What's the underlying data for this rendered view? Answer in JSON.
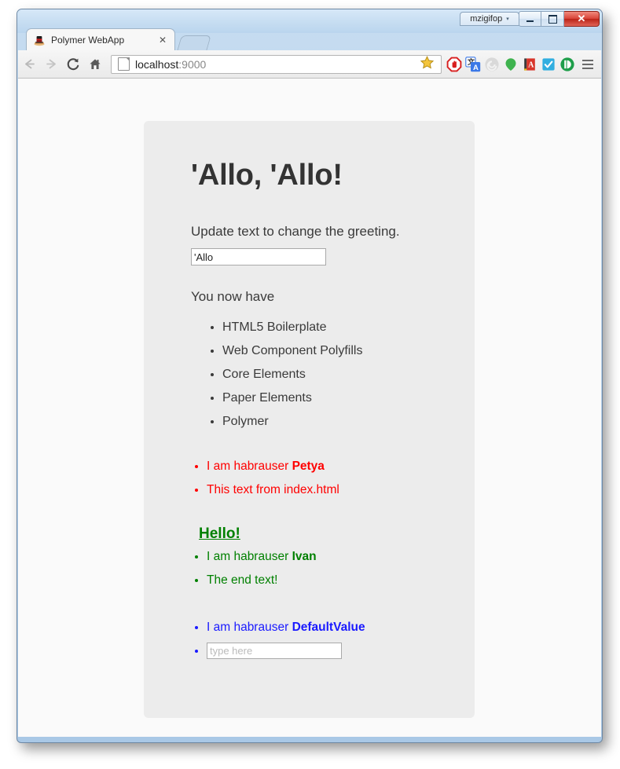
{
  "window": {
    "profile_name": "mzigifop",
    "profile_chevron": "▾",
    "minimize_label": "minimize",
    "maximize_label": "maximize",
    "close_label": "✕"
  },
  "tabs": [
    {
      "title": "Polymer WebApp",
      "close_label": "✕",
      "favicon": "polymer-webapp-favicon"
    }
  ],
  "new_tab_label": "new-tab",
  "toolbar": {
    "back_label": "←",
    "forward_label": "→",
    "reload_label": "↻",
    "home_label": "home",
    "url_host": "localhost",
    "url_port": ":9000",
    "url_full": "localhost:9000",
    "page_icon": "page-icon",
    "star_icon": "bookmark-star-icon",
    "extensions": [
      {
        "name": "adblock-icon"
      },
      {
        "name": "google-translate-icon"
      },
      {
        "name": "spiral-icon"
      },
      {
        "name": "green-balloon-icon"
      },
      {
        "name": "dictionary-book-icon"
      },
      {
        "name": "blue-checkbox-icon"
      },
      {
        "name": "pocket-icon"
      }
    ],
    "menu_label": "chrome-menu"
  },
  "page": {
    "heading": "'Allo, 'Allo!",
    "instruction": "Update text to change the greeting.",
    "greeting_input": {
      "value": "'Allo",
      "placeholder": ""
    },
    "have_text": "You now have",
    "features": [
      "HTML5 Boilerplate",
      "Web Component Polyfills",
      "Core Elements",
      "Paper Elements",
      "Polymer"
    ],
    "red_block": {
      "color": "#ff0000",
      "items": [
        {
          "prefix": "I am habrauser ",
          "strong": "Petya"
        },
        {
          "prefix": "This text from index.html",
          "strong": ""
        }
      ]
    },
    "hello_heading": "Hello!",
    "green_block": {
      "color": "#008000",
      "items": [
        {
          "prefix": "I am habrauser ",
          "strong": "Ivan"
        },
        {
          "prefix": "The end text!",
          "strong": ""
        }
      ]
    },
    "blue_block": {
      "color": "#1a1aff",
      "items": [
        {
          "prefix": "I am habrauser ",
          "strong": "DefaultValue"
        }
      ],
      "input": {
        "value": "",
        "placeholder": "type here"
      }
    }
  }
}
